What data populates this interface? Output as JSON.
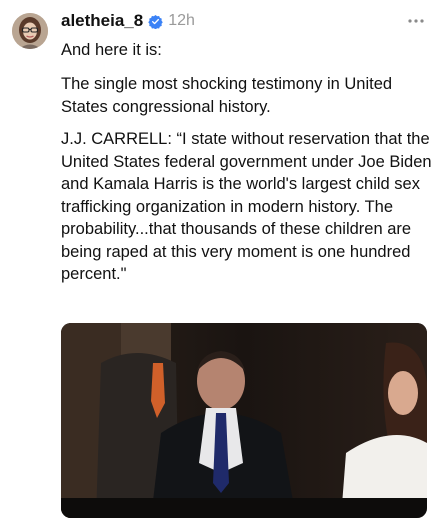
{
  "post": {
    "username": "aletheia_8",
    "timestamp": "12h",
    "verified_color": "#3b82f6",
    "avatar_icon": "avatar-photo",
    "more_icon": "ellipsis-icon",
    "paragraphs": [
      "And here it is:",
      "The single most shocking testimony in United States congressional history.",
      "J.J. CARRELL: “I state without reservation that the United States federal government under Joe Biden and Kamala Harris is the world's largest child sex trafficking organization in modern history. The probability...that thousands of these children are being raped at this very moment is one hundred percent.\""
    ],
    "media": {
      "type": "video-thumbnail"
    }
  }
}
